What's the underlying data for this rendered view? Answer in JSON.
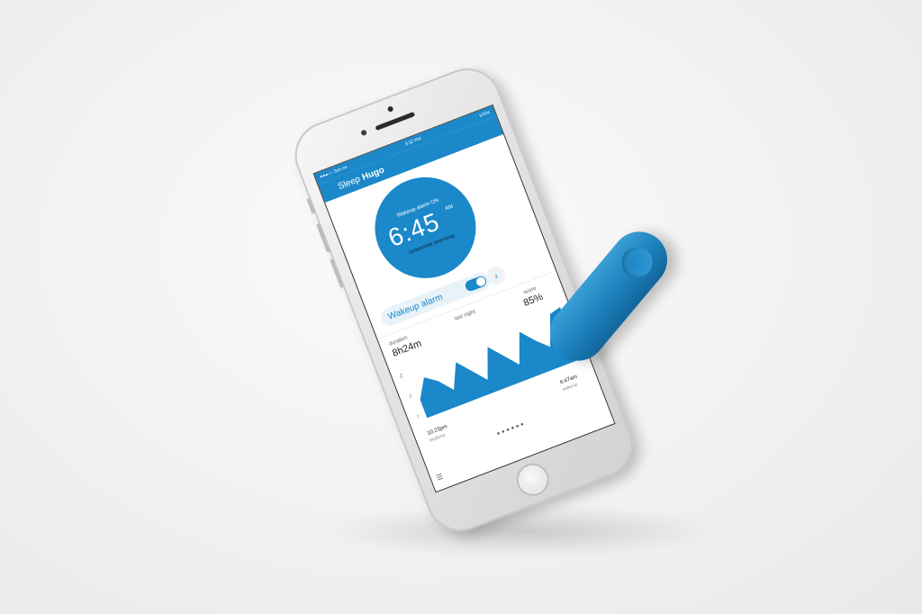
{
  "status_bar": {
    "carrier": "●●●○○ Sen.se",
    "time": "3:32 PM",
    "battery": "100%"
  },
  "nav": {
    "title_light": "Sleep",
    "title_bold": "Hugo"
  },
  "alarm": {
    "label": "Wakeup alarm ON",
    "time": "6:45",
    "ampm": "AM",
    "when": "tomorrow morning",
    "toggle_label": "Wakeup alarm",
    "toggle_on": true
  },
  "stats": {
    "duration_label": "duration",
    "duration_value": "8h24m",
    "period_label": "last night",
    "score_label": "score",
    "score_value": "85%"
  },
  "chart_data": {
    "type": "area",
    "y_axis_label": "Z",
    "bedtime_time": "10:23pm",
    "bedtime_label": "bedtime",
    "wakeup_time": "6:47am",
    "wakeup_label": "wakeup",
    "values": [
      0.35,
      0.7,
      0.55,
      0.3,
      0.75,
      0.5,
      0.25,
      0.8,
      0.55,
      0.3,
      0.85,
      0.6,
      0.4,
      0.95,
      1.0
    ]
  },
  "colors": {
    "accent": "#1a88c9",
    "pill": "#2590cc"
  },
  "icons": {
    "sound": "speaker-icon",
    "list": "list-icon",
    "pill": "sleep-sensor-pill"
  }
}
